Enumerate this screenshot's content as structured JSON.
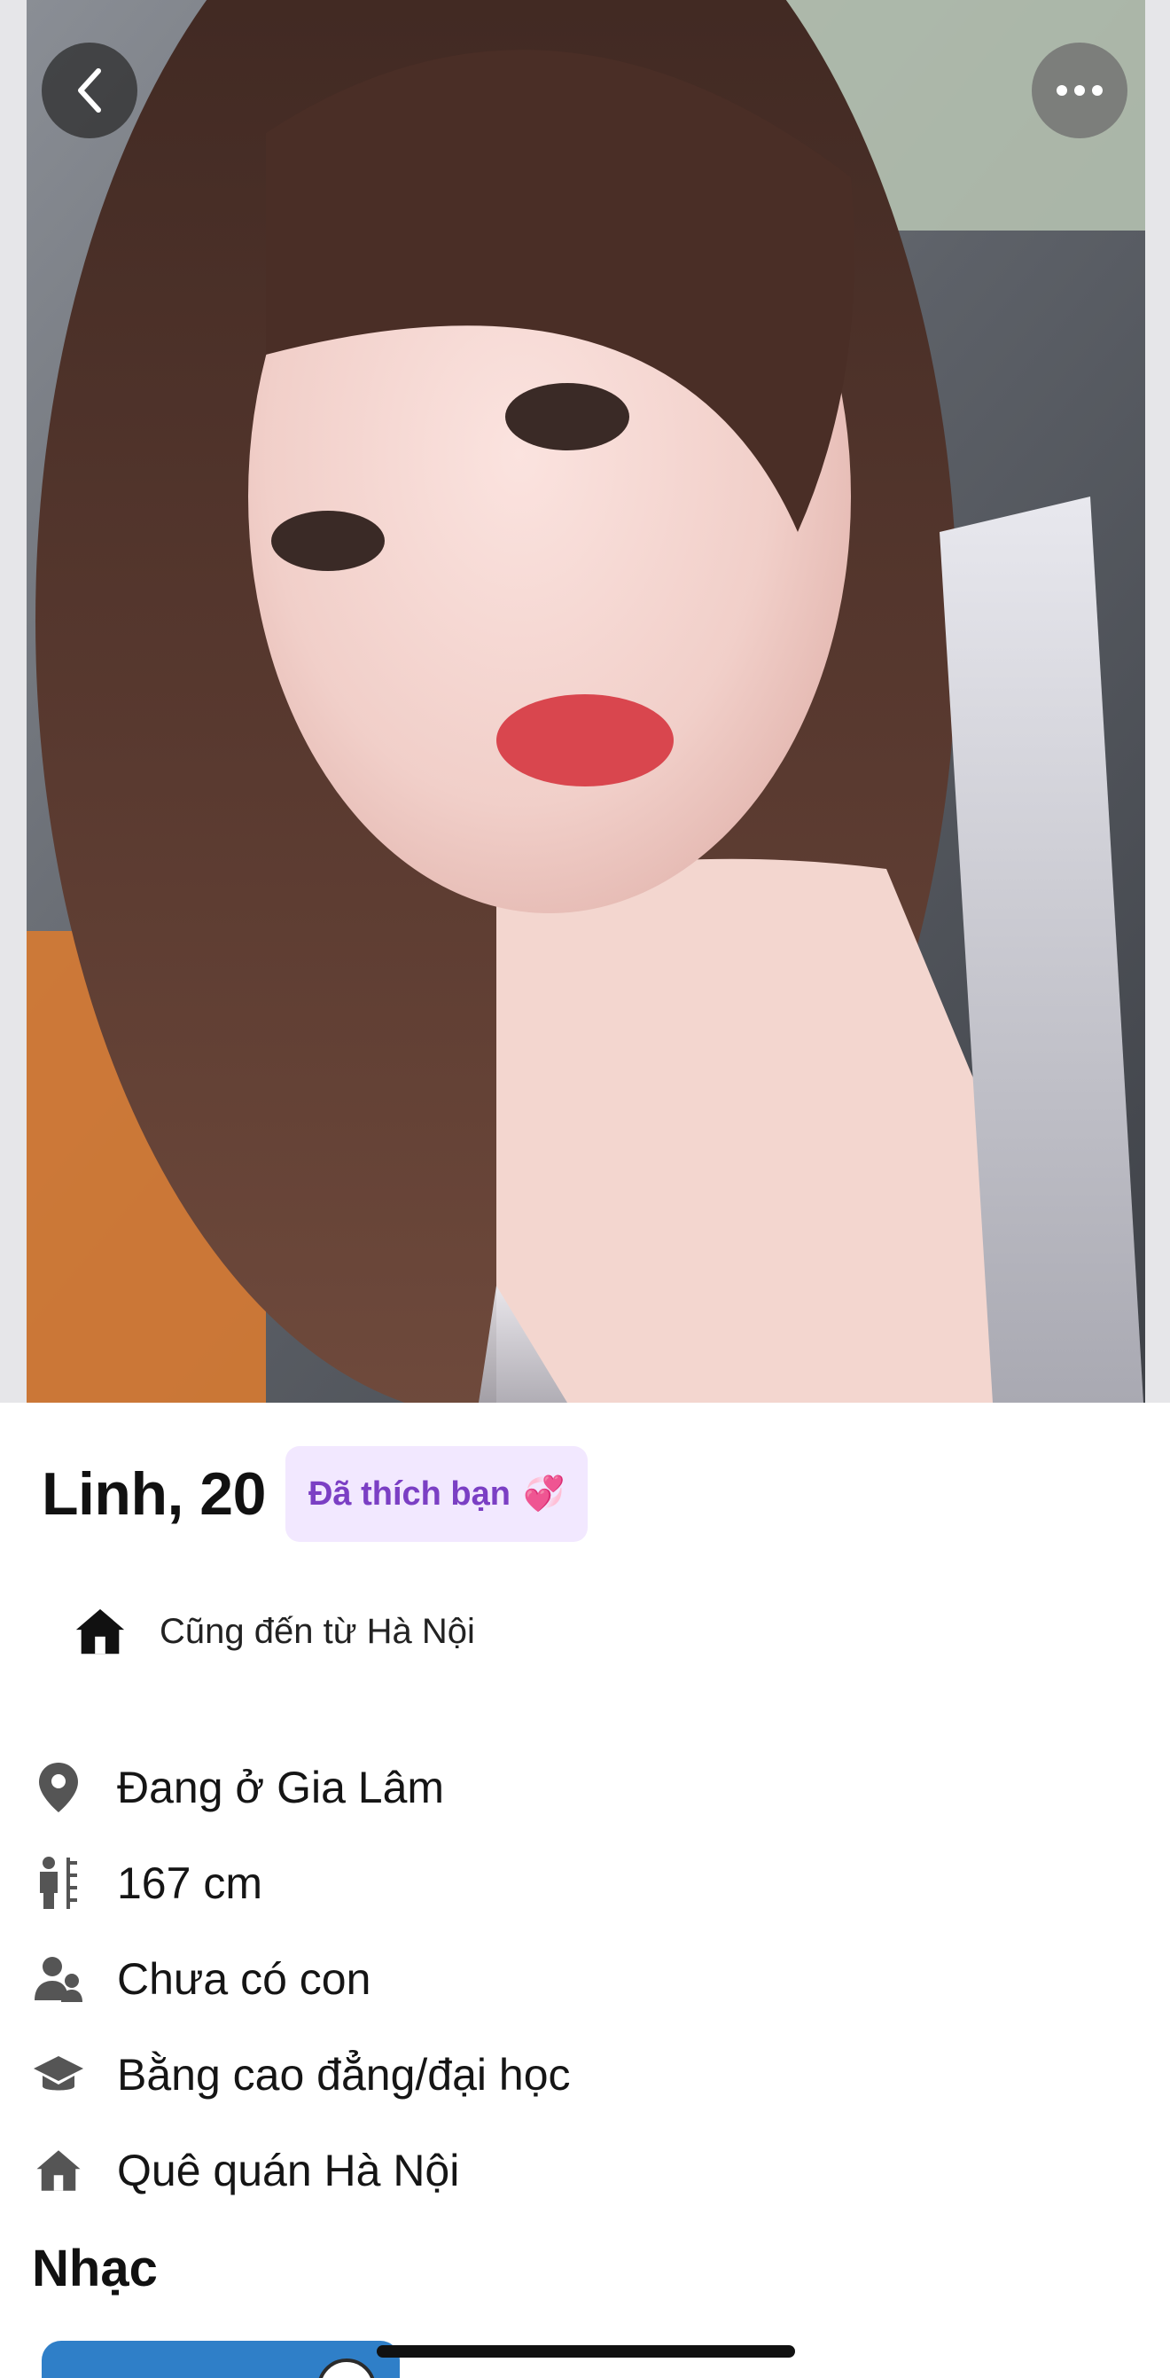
{
  "header": {
    "back_icon": "chevron-left-icon",
    "more_icon": "more-horizontal-icon"
  },
  "profile": {
    "name_age": "Linh, 20",
    "liked_badge": "Đã thích bạn",
    "liked_badge_emoji": "💞",
    "hometown_note": "Cũng đến từ Hà Nội"
  },
  "info": [
    {
      "icon": "location-pin-icon",
      "text": "Đang ở Gia Lâm"
    },
    {
      "icon": "height-ruler-icon",
      "text": "167 cm"
    },
    {
      "icon": "children-icon",
      "text": "Chưa có con"
    },
    {
      "icon": "graduation-cap-icon",
      "text": "Bằng cao đẳng/đại học"
    },
    {
      "icon": "home-icon",
      "text": "Quê quán Hà Nội"
    }
  ],
  "sections": {
    "music_title": "Nhạc"
  },
  "colors": {
    "badge_bg": "#f2e8ff",
    "badge_text": "#7b3fc4",
    "music_card": "#2f7fc8"
  }
}
